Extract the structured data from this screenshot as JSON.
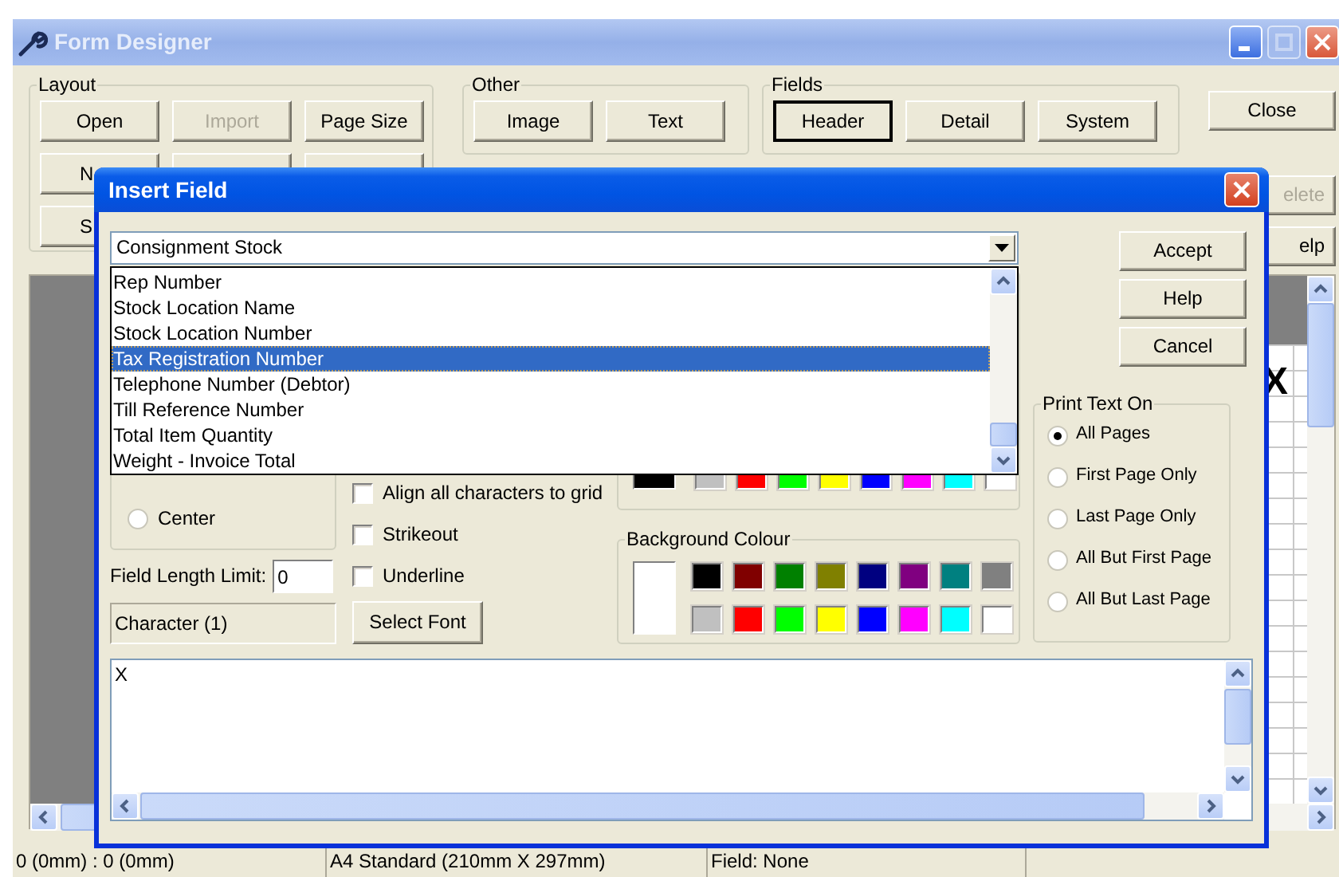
{
  "main_window": {
    "title": "Form Designer",
    "groups": [
      {
        "label": "Layout",
        "buttons": [
          {
            "label": "Open",
            "disabled": false
          },
          {
            "label": "Import",
            "disabled": true
          },
          {
            "label": "Page Size",
            "disabled": false
          },
          {
            "label": "N",
            "disabled": false,
            "kind": "head"
          },
          {
            "kind": "blank"
          },
          {
            "kind": "blank"
          },
          {
            "label": "S",
            "disabled": false,
            "kind": "head"
          }
        ]
      },
      {
        "label": "Other",
        "buttons": [
          {
            "label": "Image",
            "disabled": false
          },
          {
            "label": "Text",
            "disabled": false
          }
        ]
      },
      {
        "label": "Fields",
        "buttons": [
          {
            "label": "Header",
            "disabled": false,
            "selected": true
          },
          {
            "label": "Detail",
            "disabled": false,
            "selected": false
          },
          {
            "label": "System",
            "disabled": false,
            "selected": false
          }
        ]
      }
    ],
    "side_buttons": [
      {
        "label": "Close",
        "disabled": false
      },
      {
        "label": "elete",
        "disabled": true,
        "kind": "tail"
      },
      {
        "label": "elp",
        "disabled": false,
        "kind": "tail"
      }
    ],
    "canvas": {
      "text": "X"
    },
    "status_bar": [
      "0 (0mm) : 0 (0mm)",
      "A4 Standard (210mm X 297mm)",
      "Field: None"
    ]
  },
  "dialog": {
    "title": "Insert Field",
    "field_combo": {
      "value": "Consignment Stock",
      "expanded": true
    },
    "dropdown_items": [
      {
        "label": "Rep Number",
        "selected": false
      },
      {
        "label": "Stock Location Name",
        "selected": false
      },
      {
        "label": "Stock Location Number",
        "selected": false
      },
      {
        "label": "Tax Registration Number",
        "selected": true
      },
      {
        "label": "Telephone Number (Debtor)",
        "selected": false
      },
      {
        "label": "Till Reference Number",
        "selected": false
      },
      {
        "label": "Total Item Quantity",
        "selected": false
      },
      {
        "label": "Weight - Invoice Total",
        "selected": false
      }
    ],
    "alignment_options": [
      {
        "label": "Center",
        "selected": false
      }
    ],
    "field_length_limit": {
      "label": "Field Length Limit:",
      "value": "0"
    },
    "type_display": "Character (1)",
    "checkboxes": [
      {
        "label": "Align all characters to grid",
        "checked": false
      },
      {
        "label": "Strikeout",
        "checked": false
      },
      {
        "label": "Underline",
        "checked": false
      }
    ],
    "select_font_button": "Select Font",
    "font_colour": {
      "preview": {
        "color": "#000000"
      },
      "swatches": [
        {
          "color": "#c0c0c0"
        },
        {
          "color": "#ff0000"
        },
        {
          "color": "#00ff00"
        },
        {
          "color": "#ffff00"
        },
        {
          "color": "#0000ff"
        },
        {
          "color": "#ff00ff"
        },
        {
          "color": "#00ffff"
        },
        {
          "color": "#ffffff"
        }
      ]
    },
    "background_colour": {
      "label": "Background Colour",
      "preview": {
        "color": "#ffffff"
      },
      "swatches": [
        {
          "color": "#000000"
        },
        {
          "color": "#800000"
        },
        {
          "color": "#008000"
        },
        {
          "color": "#808000"
        },
        {
          "color": "#000080"
        },
        {
          "color": "#800080"
        },
        {
          "color": "#008080"
        },
        {
          "color": "#808080"
        },
        {
          "color": "#c0c0c0"
        },
        {
          "color": "#ff0000"
        },
        {
          "color": "#00ff00"
        },
        {
          "color": "#ffff00"
        },
        {
          "color": "#0000ff"
        },
        {
          "color": "#ff00ff"
        },
        {
          "color": "#00ffff"
        },
        {
          "color": "#ffffff"
        }
      ]
    },
    "print_text_on": {
      "label": "Print Text On",
      "options": [
        {
          "label": "All Pages",
          "selected": true
        },
        {
          "label": "First Page Only",
          "selected": false
        },
        {
          "label": "Last Page Only",
          "selected": false
        },
        {
          "label": "All But First Page",
          "selected": false
        },
        {
          "label": "All But Last Page",
          "selected": false
        }
      ]
    },
    "buttons": [
      {
        "label": "Accept"
      },
      {
        "label": "Help"
      },
      {
        "label": "Cancel"
      }
    ],
    "text_content": "X"
  }
}
